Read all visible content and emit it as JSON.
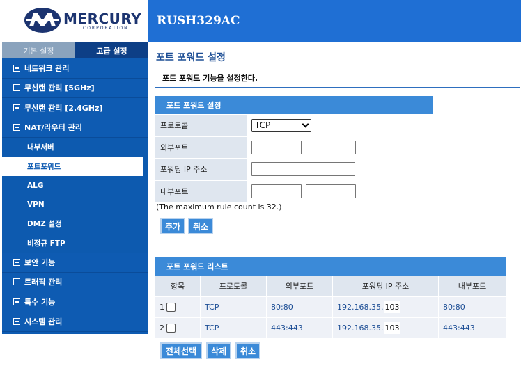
{
  "header": {
    "brand": "MERCURY",
    "brand_sub": "CORPORATION",
    "model": "RUSH329AC"
  },
  "sidebar": {
    "tabs": [
      {
        "label": "기본 설정"
      },
      {
        "label": "고급 설정"
      }
    ],
    "items": [
      {
        "label": "네트워크 관리",
        "expanded": false
      },
      {
        "label": "무선랜 관리 [5GHz]",
        "expanded": false
      },
      {
        "label": "무선랜 관리 [2.4GHz]",
        "expanded": false
      },
      {
        "label": "NAT/라우터 관리",
        "expanded": true
      },
      {
        "label": "보안 기능",
        "expanded": false
      },
      {
        "label": "트래픽 관리",
        "expanded": false
      },
      {
        "label": "특수 기능",
        "expanded": false
      },
      {
        "label": "시스템 관리",
        "expanded": false
      }
    ],
    "sub_items": [
      {
        "label": "내부서버"
      },
      {
        "label": "포트포워드",
        "active": true
      },
      {
        "label": "ALG"
      },
      {
        "label": "VPN"
      },
      {
        "label": "DMZ 설정"
      },
      {
        "label": "비정규 FTP"
      }
    ]
  },
  "main": {
    "title": "포트 포워드 설정",
    "description": "포트 포워드 기능을 설정한다.",
    "form": {
      "header": "포트 포워드 설정",
      "protocol_label": "프로토콜",
      "protocol_value": "TCP",
      "external_port_label": "외부포트",
      "ip_label": "포워딩 IP 주소",
      "internal_port_label": "내부포트",
      "note": "(The maximum rule count is 32.)",
      "add_button": "추가",
      "cancel_button": "취소"
    },
    "list": {
      "header": "포트 포워드 리스트",
      "columns": [
        "항목",
        "프로토콜",
        "외부포트",
        "포워딩 IP 주소",
        "내부포트"
      ],
      "rows": [
        {
          "index": "1",
          "protocol": "TCP",
          "external": "80:80",
          "ip_prefix": "192.168.35.",
          "ip_tail": "103",
          "internal": "80:80"
        },
        {
          "index": "2",
          "protocol": "TCP",
          "external": "443:443",
          "ip_prefix": "192.168.35.",
          "ip_tail": "103",
          "internal": "443:443"
        }
      ],
      "select_all_button": "전체선택",
      "delete_button": "삭제",
      "cancel_button": "취소"
    }
  }
}
